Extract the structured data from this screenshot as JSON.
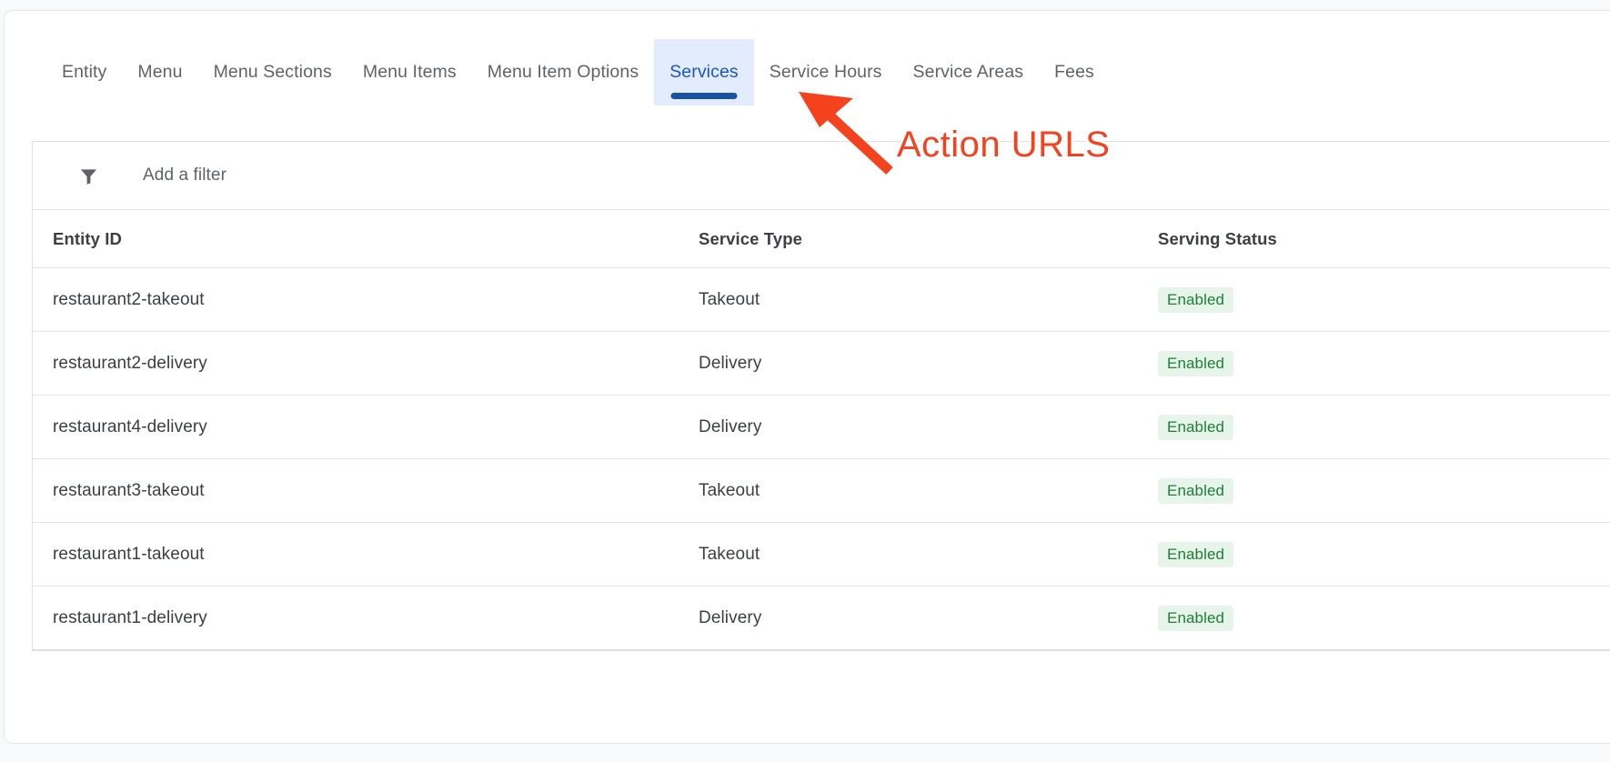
{
  "tabs": [
    {
      "label": "Entity",
      "active": false
    },
    {
      "label": "Menu",
      "active": false
    },
    {
      "label": "Menu Sections",
      "active": false
    },
    {
      "label": "Menu Items",
      "active": false
    },
    {
      "label": "Menu Item Options",
      "active": false
    },
    {
      "label": "Services",
      "active": true
    },
    {
      "label": "Service Hours",
      "active": false
    },
    {
      "label": "Service Areas",
      "active": false
    },
    {
      "label": "Fees",
      "active": false
    }
  ],
  "filter": {
    "icon": "filter-funnel-icon",
    "placeholder": "Add a filter",
    "value": ""
  },
  "table": {
    "columns": [
      "Entity ID",
      "Service Type",
      "Serving Status"
    ],
    "rows": [
      {
        "entity_id": "restaurant2-takeout",
        "service_type": "Takeout",
        "serving_status": "Enabled"
      },
      {
        "entity_id": "restaurant2-delivery",
        "service_type": "Delivery",
        "serving_status": "Enabled"
      },
      {
        "entity_id": "restaurant4-delivery",
        "service_type": "Delivery",
        "serving_status": "Enabled"
      },
      {
        "entity_id": "restaurant3-takeout",
        "service_type": "Takeout",
        "serving_status": "Enabled"
      },
      {
        "entity_id": "restaurant1-takeout",
        "service_type": "Takeout",
        "serving_status": "Enabled"
      },
      {
        "entity_id": "restaurant1-delivery",
        "service_type": "Delivery",
        "serving_status": "Enabled"
      }
    ]
  },
  "annotation": {
    "text": "Action URLS",
    "color": "#f4411e",
    "arrow": "arrow-up-left-icon"
  },
  "colors": {
    "active_tab_bg": "#e3ecfd",
    "active_tab_text": "#1a56c4",
    "active_tab_underline": "#17539f",
    "badge_bg": "#e6f4ea",
    "badge_text": "#1e7e34",
    "annotation": "#f4411e"
  }
}
